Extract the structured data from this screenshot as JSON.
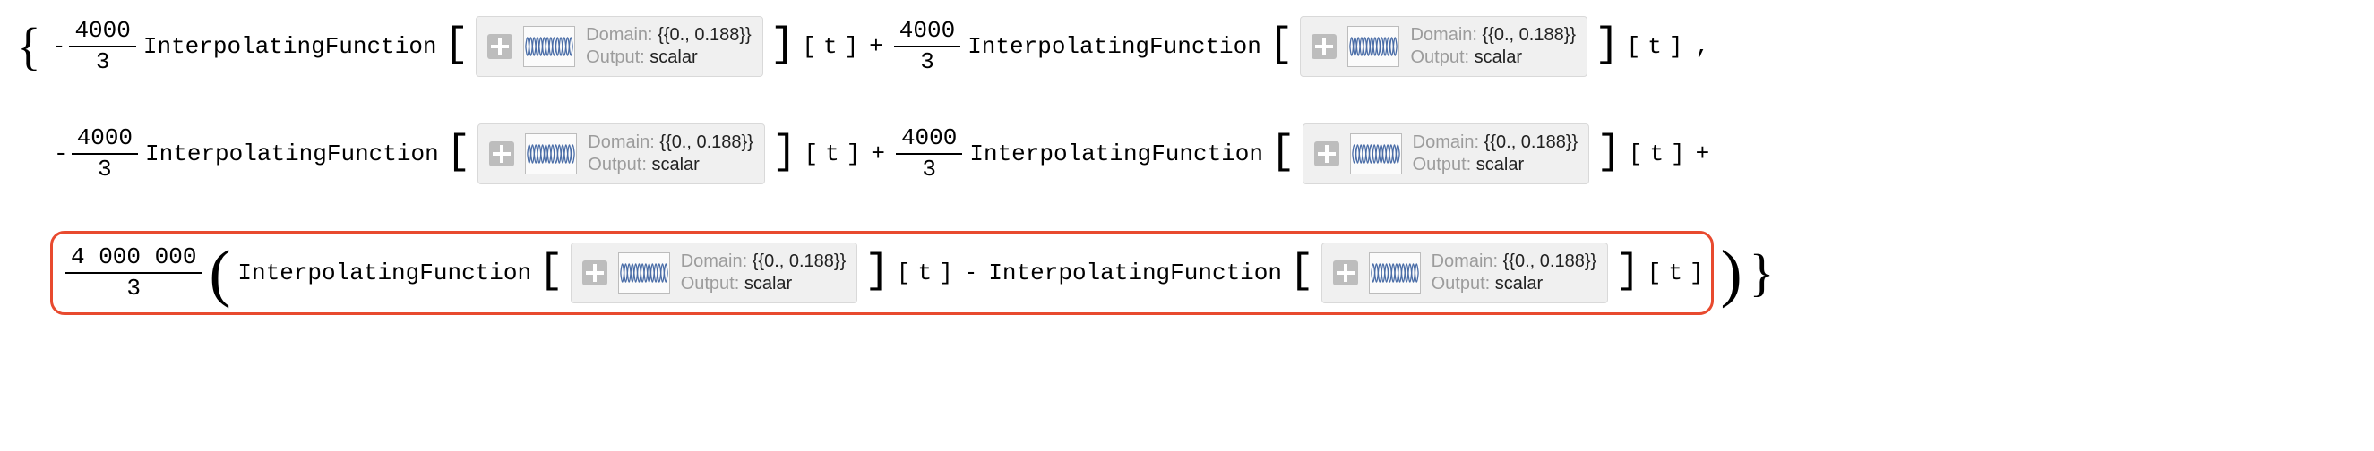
{
  "fractions": {
    "f4000_3": {
      "num": "4000",
      "den": "3"
    },
    "f4000000_3": {
      "num": "4 000 000",
      "den": "3"
    }
  },
  "labels": {
    "interp": "InterpolatingFunction",
    "domain_key": "Domain: ",
    "domain_val": "{{0., 0.188}}",
    "output_key": "Output: ",
    "output_val": "scalar",
    "var_open": "[",
    "var_close": "]",
    "var_t": "t"
  },
  "ops": {
    "minus": "-",
    "plus": "+",
    "comma": ",",
    "list_open": "{",
    "list_close": "}",
    "paren_open": "(",
    "paren_close": ")"
  }
}
